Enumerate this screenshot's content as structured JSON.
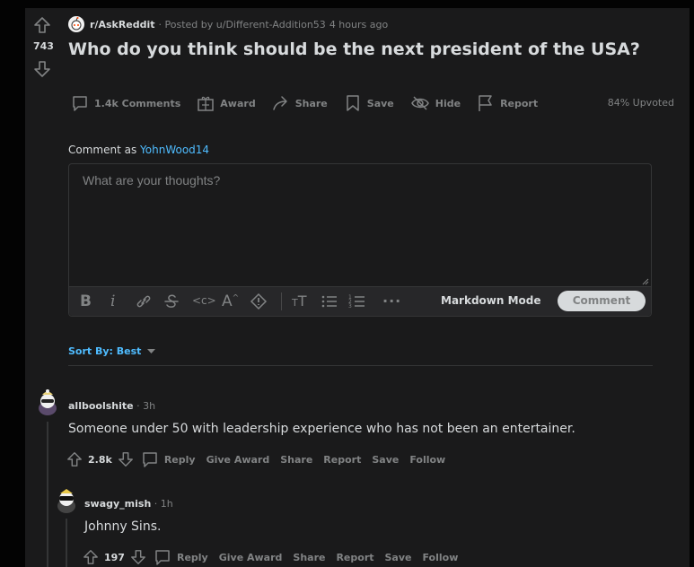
{
  "post": {
    "score": "743",
    "subreddit": "r/AskReddit",
    "posted_by": "· Posted by u/Different-Addition53",
    "time": "4 hours ago",
    "title": "Who do you think should be the next president of the USA?",
    "actions": {
      "comments": "1.4k Comments",
      "award": "Award",
      "share": "Share",
      "save": "Save",
      "hide": "Hide",
      "report": "Report"
    },
    "upvoted": "84% Upvoted"
  },
  "composer": {
    "comment_as_label": "Comment as",
    "username": "YohnWood14",
    "placeholder": "What are your thoughts?",
    "markdown_mode": "Markdown Mode",
    "submit": "Comment"
  },
  "sort": {
    "label": "Sort By: Best"
  },
  "comments": [
    {
      "author": "allboolshite",
      "time": "· 3h",
      "body": "Someone under 50 with leadership experience who has not been an entertainer.",
      "points": "2.8k",
      "actions": [
        "Reply",
        "Give Award",
        "Share",
        "Report",
        "Save",
        "Follow"
      ]
    },
    {
      "author": "swagy_mish",
      "time": "· 1h",
      "body": "Johnny Sins.",
      "points": "197",
      "actions": [
        "Reply",
        "Give Award",
        "Share",
        "Report",
        "Save",
        "Follow"
      ]
    }
  ],
  "colors": {
    "background": "#030303",
    "card": "#1a1a1b",
    "text": "#d7dadc",
    "muted": "#818384",
    "link": "#4fbcff"
  }
}
